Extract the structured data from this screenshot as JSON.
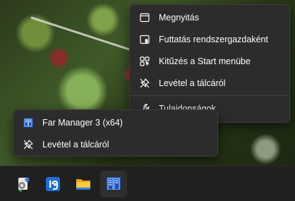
{
  "jump_menu_top": {
    "items": [
      {
        "label": "Megnyitás",
        "icon": "open-window-icon"
      },
      {
        "label": "Futtatás rendszergazdaként",
        "icon": "shield-admin-icon"
      },
      {
        "label": "Kitűzés a Start menübe",
        "icon": "pin-start-icon"
      },
      {
        "label": "Levétel a tálcáról",
        "icon": "unpin-icon"
      },
      {
        "label": "Tulajdonságok",
        "icon": "wrench-icon"
      }
    ]
  },
  "jump_menu_bottom": {
    "items": [
      {
        "label": "Far Manager 3 (x64)",
        "icon": "far-manager-icon"
      },
      {
        "label": "Levétel a tálcáról",
        "icon": "unpin-icon"
      }
    ]
  },
  "taskbar": {
    "apps": [
      {
        "name": "system-tool-app",
        "icon": "gear-document-icon"
      },
      {
        "name": "irfanview-app",
        "icon": "irfanview-icon"
      },
      {
        "name": "file-explorer-app",
        "icon": "folder-icon"
      },
      {
        "name": "far-manager-app",
        "icon": "far-manager-icon",
        "active": true
      }
    ]
  },
  "colors": {
    "menu_bg": "#2c2c2c",
    "taskbar_bg": "#202020",
    "far_blue": "#2f6fd6"
  }
}
